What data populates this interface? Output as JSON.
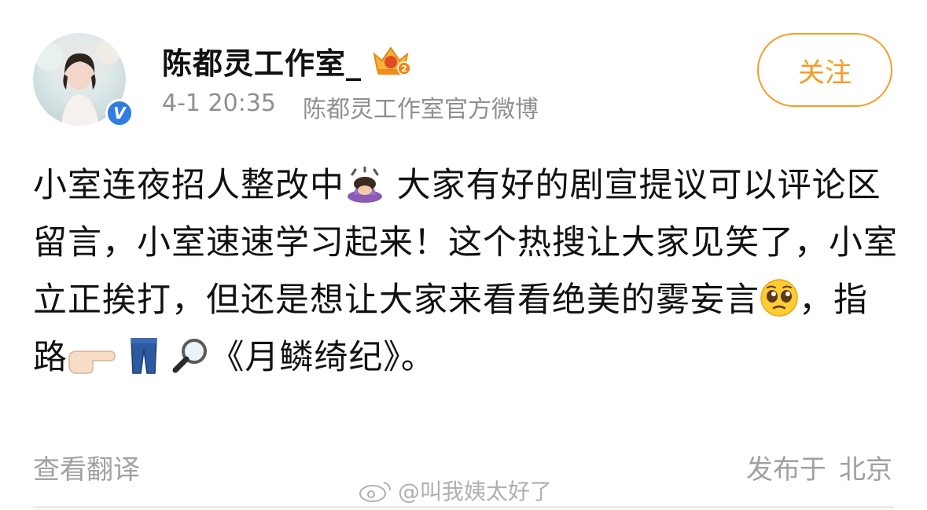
{
  "header": {
    "username": "陈都灵工作室_",
    "timestamp": "4-1 20:35",
    "source": "陈都灵工作室官方微博",
    "verified_badge": "V",
    "follow_label": "关注",
    "accent_color": "#f59d26",
    "verified_color": "#2f7de1",
    "icons": [
      "avatar",
      "verified-icon",
      "vip-crown-icon"
    ]
  },
  "post": {
    "segments": [
      "小室连夜招人整改中",
      " 大家有好的剧宣提议可以评论区留言，小室速速学习起来！这个热搜让大家见笑了，小室立正挨打，但还是想让大家来看看绝美的雾妄言",
      "，指路",
      "《月鳞绮纪》。"
    ],
    "emojis": [
      "woman-bowing-emoji",
      "pleading-face-emoji",
      "pointing-right-emoji",
      "jeans-emoji",
      "magnifying-glass-emoji"
    ]
  },
  "footer": {
    "translate_label": "查看翻译",
    "location_prefix": "发布于",
    "location": "北京",
    "watermark": "@叫我姨太好了"
  }
}
